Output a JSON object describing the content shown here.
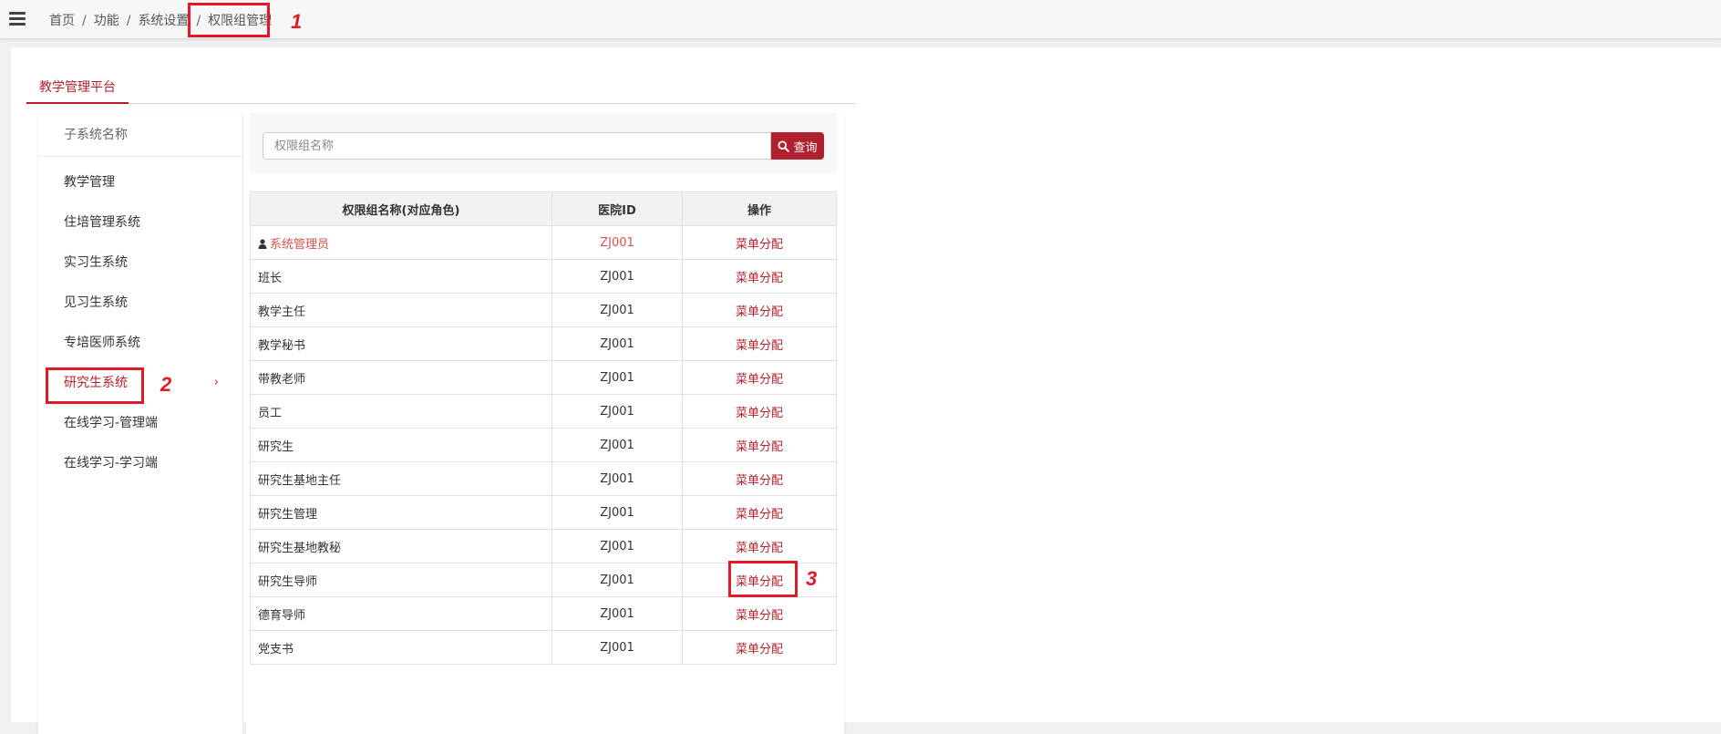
{
  "breadcrumb": {
    "items": [
      "首页",
      "功能",
      "系统设置"
    ],
    "current": "权限组管理",
    "separator": "/"
  },
  "annotations": [
    "1",
    "2",
    "3"
  ],
  "tab": {
    "label": "教学管理平台"
  },
  "sidebar": {
    "header": "子系统名称",
    "items": [
      {
        "label": "教学管理"
      },
      {
        "label": "住培管理系统"
      },
      {
        "label": "实习生系统"
      },
      {
        "label": "见习生系统"
      },
      {
        "label": "专培医师系统"
      },
      {
        "label": "研究生系统",
        "active": true
      },
      {
        "label": "在线学习-管理端"
      },
      {
        "label": "在线学习-学习端"
      }
    ],
    "active_chevron": "›"
  },
  "search": {
    "placeholder": "权限组名称",
    "button_label": "查询"
  },
  "table": {
    "columns": [
      "权限组名称(对应角色)",
      "医院ID",
      "操作"
    ],
    "action_label": "菜单分配",
    "rows": [
      {
        "name": "系统管理员",
        "hospital_id": "ZJ001",
        "admin": true
      },
      {
        "name": "班长",
        "hospital_id": "ZJ001"
      },
      {
        "name": "教学主任",
        "hospital_id": "ZJ001"
      },
      {
        "name": "教学秘书",
        "hospital_id": "ZJ001"
      },
      {
        "name": "带教老师",
        "hospital_id": "ZJ001"
      },
      {
        "name": "员工",
        "hospital_id": "ZJ001"
      },
      {
        "name": "研究生",
        "hospital_id": "ZJ001"
      },
      {
        "name": "研究生基地主任",
        "hospital_id": "ZJ001"
      },
      {
        "name": "研究生管理",
        "hospital_id": "ZJ001"
      },
      {
        "name": "研究生基地教秘",
        "hospital_id": "ZJ001"
      },
      {
        "name": "研究生导师",
        "hospital_id": "ZJ001"
      },
      {
        "name": "德育导师",
        "hospital_id": "ZJ001"
      },
      {
        "name": "党支书",
        "hospital_id": "ZJ001"
      }
    ]
  },
  "colors": {
    "accent": "#b5202e",
    "annotation": "#e3192a",
    "admin_text": "#d9534f"
  }
}
